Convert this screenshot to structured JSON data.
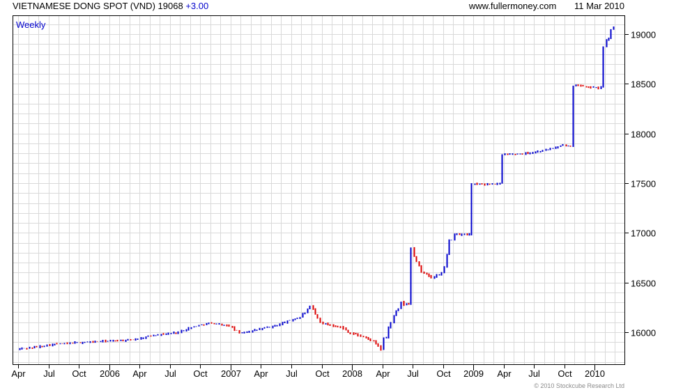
{
  "header": {
    "title": "VIETNAMESE DONG SPOT (VND)",
    "last_value": "19068",
    "change": "+3.00",
    "website": "www.fullermoney.com",
    "date": "11 Mar 2010"
  },
  "footer": {
    "copyright": "© 2010 Stockcube Research Ltd"
  },
  "colors": {
    "up": "#0000cc",
    "down": "#dd0000",
    "grid": "#d9d9d9"
  },
  "chart_data": {
    "type": "line",
    "frequency_label": "Weekly",
    "y_ticks": [
      16000,
      16500,
      17000,
      17500,
      18000,
      18500,
      19000
    ],
    "ylim": [
      15670,
      19190
    ],
    "x_tick_labels": [
      "Apr",
      "Jul",
      "Oct",
      "2006",
      "Apr",
      "Jul",
      "Oct",
      "2007",
      "Apr",
      "Jul",
      "Oct",
      "2008",
      "Apr",
      "Jul",
      "Oct",
      "2009",
      "Apr",
      "Jul",
      "Oct",
      "2010"
    ],
    "x_range": [
      "2005-04",
      "2010-03"
    ],
    "grid": true,
    "series": [
      {
        "points": [
          [
            "2005-04",
            15830
          ],
          [
            "2005-05",
            15840
          ],
          [
            "2005-06",
            15850
          ],
          [
            "2005-07",
            15870
          ],
          [
            "2005-08",
            15880
          ],
          [
            "2005-09",
            15885
          ],
          [
            "2005-10",
            15895
          ],
          [
            "2005-11",
            15900
          ],
          [
            "2005-12",
            15905
          ],
          [
            "2006-01",
            15910
          ],
          [
            "2006-02",
            15915
          ],
          [
            "2006-03",
            15920
          ],
          [
            "2006-04",
            15930
          ],
          [
            "2006-05",
            15960
          ],
          [
            "2006-06",
            15975
          ],
          [
            "2006-07",
            15985
          ],
          [
            "2006-08",
            16000
          ],
          [
            "2006-09",
            16040
          ],
          [
            "2006-10",
            16070
          ],
          [
            "2006-11",
            16090
          ],
          [
            "2006-12",
            16080
          ],
          [
            "2007-01",
            16060
          ],
          [
            "2007-02",
            15990
          ],
          [
            "2007-03",
            16010
          ],
          [
            "2007-04",
            16030
          ],
          [
            "2007-05",
            16050
          ],
          [
            "2007-06",
            16080
          ],
          [
            "2007-07",
            16120
          ],
          [
            "2007-08",
            16150
          ],
          [
            "2007-09",
            16250
          ],
          [
            "2007-10",
            16100
          ],
          [
            "2007-11",
            16070
          ],
          [
            "2007-12",
            16050
          ],
          [
            "2008-01",
            15990
          ],
          [
            "2008-02",
            15960
          ],
          [
            "2008-03",
            15920
          ],
          [
            "2008-04",
            15830
          ],
          [
            "2008-05",
            16110
          ],
          [
            "2008-06",
            16280
          ],
          [
            "2008-07",
            16850
          ],
          [
            "2008-08",
            16620
          ],
          [
            "2008-09",
            16540
          ],
          [
            "2008-10",
            16600
          ],
          [
            "2008-11",
            16980
          ],
          [
            "2008-12",
            16980
          ],
          [
            "2009-01",
            17490
          ],
          [
            "2009-02",
            17490
          ],
          [
            "2009-03",
            17490
          ],
          [
            "2009-04",
            17790
          ],
          [
            "2009-05",
            17790
          ],
          [
            "2009-06",
            17800
          ],
          [
            "2009-07",
            17810
          ],
          [
            "2009-08",
            17830
          ],
          [
            "2009-09",
            17850
          ],
          [
            "2009-10",
            17880
          ],
          [
            "2009-11",
            18480
          ],
          [
            "2009-12",
            18480
          ],
          [
            "2010-01",
            18460
          ],
          [
            "2010-02",
            18870
          ],
          [
            "2010-03",
            19068
          ]
        ]
      }
    ]
  }
}
